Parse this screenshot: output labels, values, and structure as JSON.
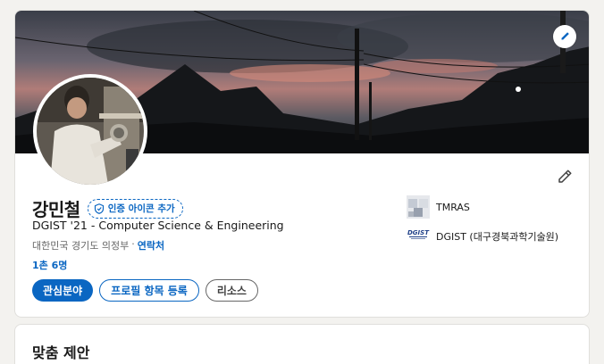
{
  "profile": {
    "name": "강민철",
    "verify_label": "인증 아이콘 추가",
    "headline": "DGIST '21 - Computer Science & Engineering",
    "location": "대한민국 경기도 의정부",
    "location_separator": "·",
    "contact_label": "연락처",
    "connections": "1촌 6명"
  },
  "buttons": {
    "interests": "관심분야",
    "add_section": "프로필 항목 등록",
    "resources": "리소스"
  },
  "organizations": [
    {
      "name": "TMRAS",
      "icon": "company-logo-icon"
    },
    {
      "name": "DGIST (대구경북과학기술원)",
      "icon": "school-logo-icon",
      "logo_text": "DGIST"
    }
  ],
  "suggestions": {
    "title": "맞춤 제안"
  },
  "colors": {
    "accent": "#0a66c2",
    "background": "#f3f2ef"
  }
}
